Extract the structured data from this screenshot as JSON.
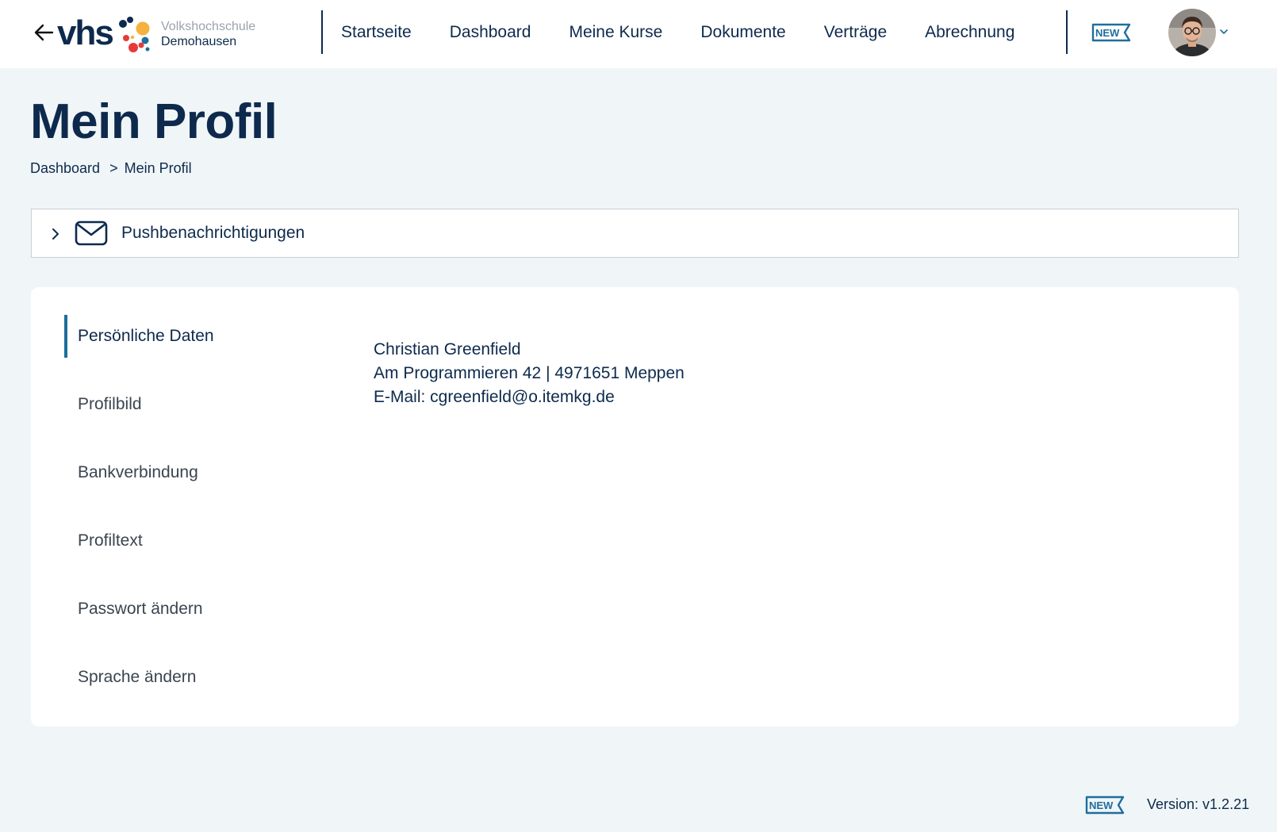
{
  "header": {
    "logo_text": "vhs",
    "org_line1": "Volkshochschule",
    "org_line2": "Demohausen",
    "nav": [
      {
        "label": "Startseite"
      },
      {
        "label": "Dashboard"
      },
      {
        "label": "Meine Kurse"
      },
      {
        "label": "Dokumente"
      },
      {
        "label": "Verträge"
      },
      {
        "label": "Abrechnung"
      }
    ],
    "new_badge": "NEW"
  },
  "page": {
    "title": "Mein Profil",
    "breadcrumb": [
      {
        "label": "Dashboard"
      },
      {
        "label": "Mein Profil"
      }
    ],
    "breadcrumb_sep": ">"
  },
  "accordion": {
    "label": "Pushbenachrichtigungen"
  },
  "sidebar": {
    "items": [
      {
        "label": "Persönliche Daten",
        "active": true
      },
      {
        "label": "Profilbild"
      },
      {
        "label": "Bankverbindung"
      },
      {
        "label": "Profiltext"
      },
      {
        "label": "Passwort ändern"
      },
      {
        "label": "Sprache ändern"
      }
    ]
  },
  "profile": {
    "name": "Christian Greenfield",
    "address": "Am Programmieren 42 | 4971651 Meppen",
    "email": "E-Mail: cgreenfield@o.itemkg.de"
  },
  "footer": {
    "new_badge": "NEW",
    "version": "Version: v1.2.21"
  },
  "colors": {
    "navy": "#0d2a4d",
    "accent": "#1f6e9c",
    "background": "#f0f5f7",
    "logo_dots": [
      "#f3b33d",
      "#e63a3a",
      "#1f6e9c"
    ]
  },
  "icons": {
    "back": "arrow-left-icon",
    "mail": "envelope-icon",
    "chevron": "chevron-right-icon",
    "avatar_chevron": "chevron-down-icon"
  }
}
